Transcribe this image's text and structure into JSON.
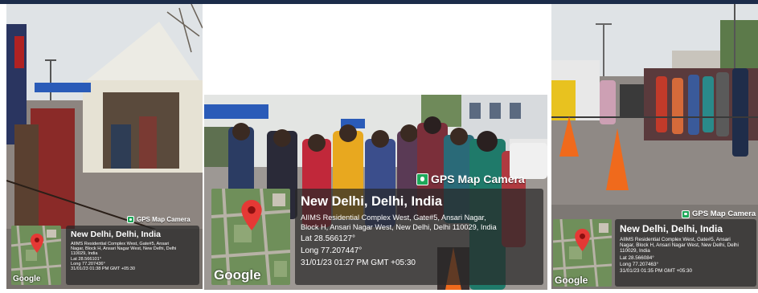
{
  "stamps": [
    {
      "camera_label": "GPS Map Camera",
      "map_provider": "Google",
      "title": "New Delhi, Delhi, India",
      "address": [
        "AIIMS Residential Complex West, Gate#5, Ansari",
        "Nagar, Block H, Ansari Nagar West, New Delhi, Delhi",
        "110029, India"
      ],
      "lat": "Lat 28.566101°",
      "long": "Long 77.207436°",
      "datetime": "31/01/23 01:38 PM GMT +05:30"
    },
    {
      "camera_label": "GPS Map Camera",
      "map_provider": "Google",
      "title": "New Delhi, Delhi, India",
      "address": [
        "AIIMS Residential Complex West, Gate#5, Ansari Nagar,",
        "Block H, Ansari Nagar West, New Delhi, Delhi 110029, India"
      ],
      "lat": "Lat 28.566127°",
      "long": "Long 77.207447°",
      "datetime": "31/01/23 01:27 PM GMT +05:30"
    },
    {
      "camera_label": "GPS Map Camera",
      "map_provider": "Google",
      "title": "New Delhi, Delhi, India",
      "address": [
        "AIIMS Residential Complex West, Gate#5, Ansari",
        "Nagar, Block H, Ansari Nagar West, New Delhi, Delhi",
        "110029, India"
      ],
      "lat": "Lat 28.566084°",
      "long": "Long 77.207463°",
      "datetime": "31/01/23 01:35 PM GMT +05:30"
    }
  ],
  "colors": {
    "sky": "#dfe3e6",
    "road": "#8a8480",
    "tent": "#e8e6dc",
    "map_green": "#6f8f5a",
    "pin": "#e53935",
    "cone": "#f06a1c",
    "badge_green": "#1fa85a"
  }
}
